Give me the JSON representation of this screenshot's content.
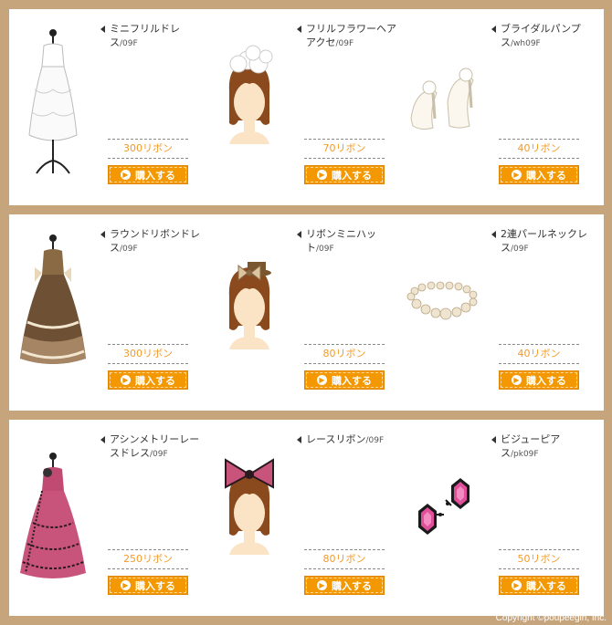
{
  "rows": [
    {
      "items": [
        {
          "name": "ミニフリルドレス",
          "code": "/09F",
          "price": "300リボン",
          "button": "購入する",
          "icon": "white-dress-icon"
        },
        {
          "name": "フリルフラワーヘアアクセ",
          "code": "/09F",
          "price": "70リボン",
          "button": "購入する",
          "icon": "flower-hair-accessory-icon"
        },
        {
          "name": "ブライダルパンプス",
          "code": "/wh09F",
          "price": "40リボン",
          "button": "購入する",
          "icon": "bridal-pumps-icon"
        }
      ]
    },
    {
      "items": [
        {
          "name": "ラウンドリボンドレス",
          "code": "/09F",
          "price": "300リボン",
          "button": "購入する",
          "icon": "brown-ribbon-dress-icon"
        },
        {
          "name": "リボンミニハット",
          "code": "/09F",
          "price": "80リボン",
          "button": "購入する",
          "icon": "ribbon-mini-hat-icon"
        },
        {
          "name": "2連パールネックレス",
          "code": "/09F",
          "price": "40リボン",
          "button": "購入する",
          "icon": "pearl-necklace-icon"
        }
      ]
    },
    {
      "items": [
        {
          "name": "アシンメトリーレースドレス",
          "code": "/09F",
          "price": "250リボン",
          "button": "購入する",
          "icon": "pink-lace-dress-icon"
        },
        {
          "name": "レースリボン",
          "code": "/09F",
          "price": "80リボン",
          "button": "購入する",
          "icon": "lace-ribbon-icon"
        },
        {
          "name": "ビジューピアス",
          "code": "/pk09F",
          "price": "50リボン",
          "button": "購入する",
          "icon": "bijou-earrings-icon"
        }
      ]
    }
  ],
  "footer": {
    "copyright": "Copyright ©poupeegirl, Inc."
  },
  "colors": {
    "background": "#c6a47c",
    "price": "#f39a2a",
    "button": "#f39800"
  }
}
